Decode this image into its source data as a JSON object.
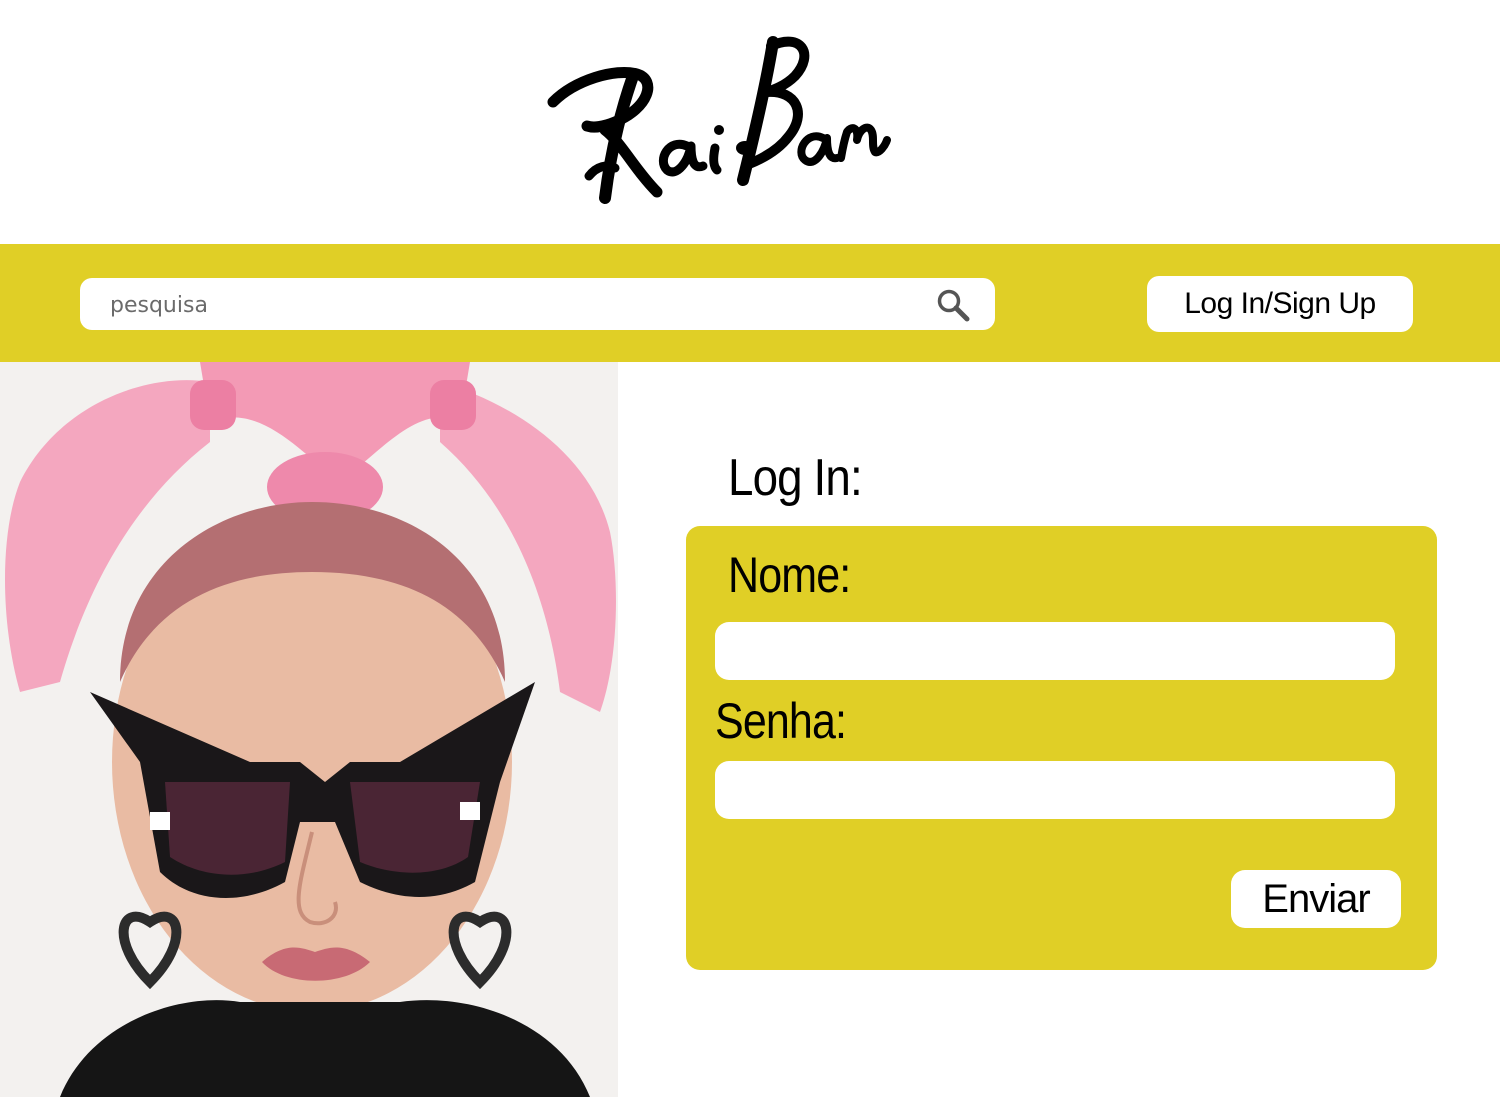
{
  "brand": {
    "logo_text": "Rai-Bam"
  },
  "colors": {
    "accent": "#e0cf26",
    "white": "#ffffff",
    "text": "#000000"
  },
  "search": {
    "placeholder": "pesquisa",
    "value": "",
    "icon": "search-icon"
  },
  "header": {
    "login_signup_label": "Log In/Sign Up"
  },
  "login": {
    "title": "Log In:",
    "name_label": "Nome:",
    "name_value": "",
    "password_label": "Senha:",
    "password_value": "",
    "submit_label": "Enviar"
  }
}
